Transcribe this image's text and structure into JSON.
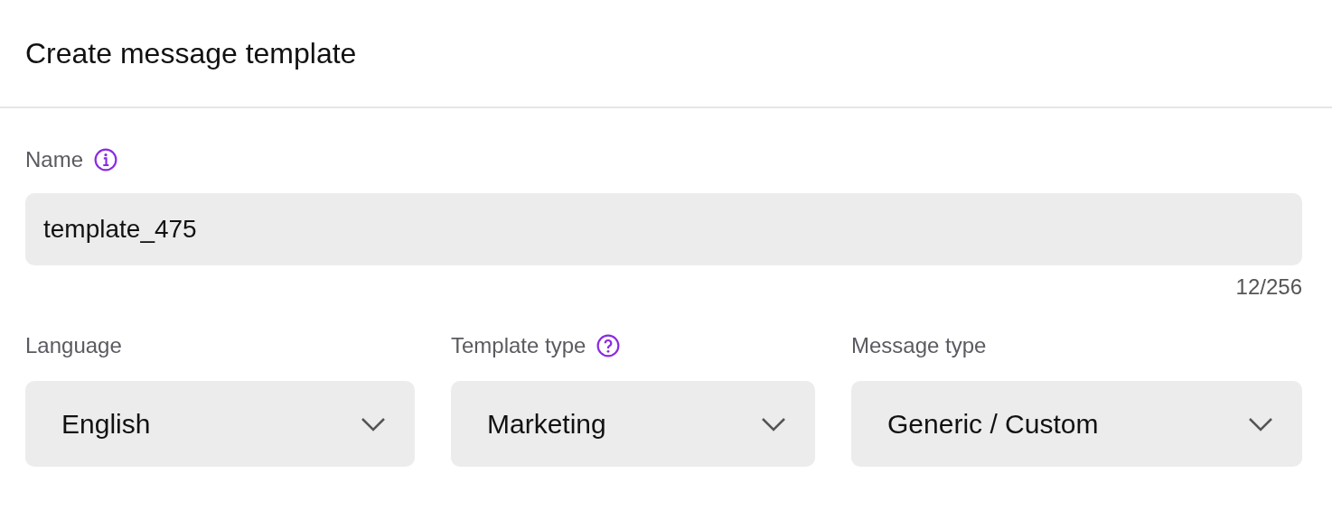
{
  "title": "Create message template",
  "name_field": {
    "label": "Name",
    "help": {
      "kind": "info"
    },
    "value": "template_475",
    "counter": "12/256"
  },
  "selects": [
    {
      "label": "Language",
      "value": "English"
    },
    {
      "label": "Template type",
      "help": {
        "kind": "question"
      },
      "value": "Marketing"
    },
    {
      "label": "Message type",
      "value": "Generic / Custom"
    }
  ]
}
